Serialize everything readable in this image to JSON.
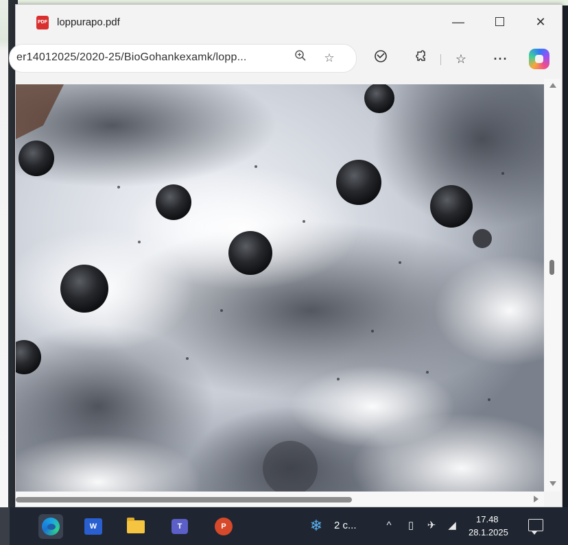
{
  "window": {
    "title": "loppurapo.pdf",
    "pdf_icon_label": "PDF",
    "controls": {
      "minimize": "—",
      "maximize": "",
      "close": "✕"
    }
  },
  "toolbar": {
    "url": "er14012025/2020-25/BioGohankexamk/lopp...",
    "icons": [
      "zoom-icon",
      "favorite-star-icon",
      "browser-essentials-icon",
      "extensions-icon",
      "favorites-icon",
      "more-icon",
      "copilot-icon"
    ],
    "more_label": "···"
  },
  "viewer": {
    "content": "photo of dark round droppings on snow",
    "accent_color": "#1f2631"
  },
  "taskbar": {
    "apps": [
      "edge",
      "word",
      "file-explorer",
      "teams",
      "powerpoint"
    ],
    "word_letter": "W",
    "teams_letter": "T",
    "ppt_letter": "P",
    "weather": "2 c...",
    "time": "17.48",
    "date": "28.1.2025"
  }
}
